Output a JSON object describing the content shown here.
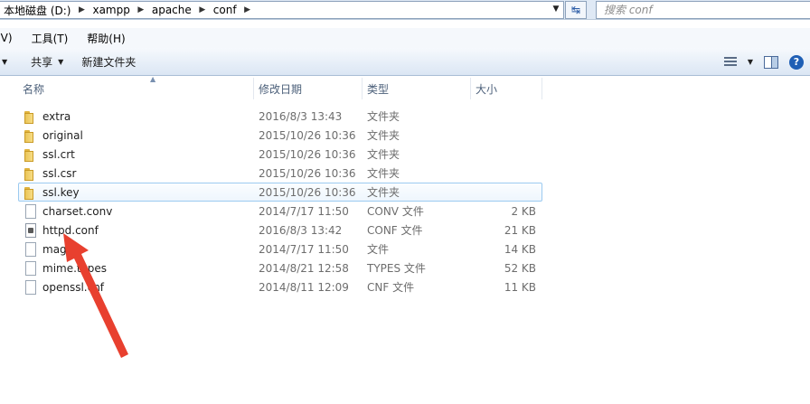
{
  "address_bar": {
    "crumbs": [
      "本地磁盘 (D:)",
      "xampp",
      "apache",
      "conf"
    ],
    "dropdown_icon": "chevron-down-icon",
    "refresh_icon": "refresh-icon"
  },
  "search": {
    "placeholder": "搜索 conf"
  },
  "menu": {
    "items": [
      "(V)",
      "工具(T)",
      "帮助(H)"
    ]
  },
  "toolbar": {
    "share_label": "共享",
    "new_folder_label": "新建文件夹",
    "view_icon": "view-details-icon",
    "pane_icon": "preview-pane-icon",
    "help_icon": "help-icon",
    "help_glyph": "?"
  },
  "columns": {
    "name": "名称",
    "date": "修改日期",
    "type": "类型",
    "size": "大小"
  },
  "files": [
    {
      "name": "extra",
      "date": "2016/8/3 13:43",
      "type": "文件夹",
      "size": "",
      "icon": "folder-icon"
    },
    {
      "name": "original",
      "date": "2015/10/26 10:36",
      "type": "文件夹",
      "size": "",
      "icon": "folder-icon"
    },
    {
      "name": "ssl.crt",
      "date": "2015/10/26 10:36",
      "type": "文件夹",
      "size": "",
      "icon": "folder-icon"
    },
    {
      "name": "ssl.csr",
      "date": "2015/10/26 10:36",
      "type": "文件夹",
      "size": "",
      "icon": "folder-icon"
    },
    {
      "name": "ssl.key",
      "date": "2015/10/26 10:36",
      "type": "文件夹",
      "size": "",
      "icon": "folder-icon",
      "selected": true
    },
    {
      "name": "charset.conv",
      "date": "2014/7/17 11:50",
      "type": "CONV 文件",
      "size": "2 KB",
      "icon": "file-icon"
    },
    {
      "name": "httpd.conf",
      "date": "2016/8/3 13:42",
      "type": "CONF 文件",
      "size": "21 KB",
      "icon": "config-file-icon"
    },
    {
      "name": "magic",
      "date": "2014/7/17 11:50",
      "type": "文件",
      "size": "14 KB",
      "icon": "file-icon"
    },
    {
      "name": "mime.types",
      "date": "2014/8/21 12:58",
      "type": "TYPES 文件",
      "size": "52 KB",
      "icon": "file-icon"
    },
    {
      "name": "openssl.cnf",
      "date": "2014/8/11 12:09",
      "type": "CNF 文件",
      "size": "11 KB",
      "icon": "file-icon"
    }
  ],
  "colors": {
    "annotation_arrow": "#e8402f",
    "selection_border": "#9ccaf0"
  }
}
